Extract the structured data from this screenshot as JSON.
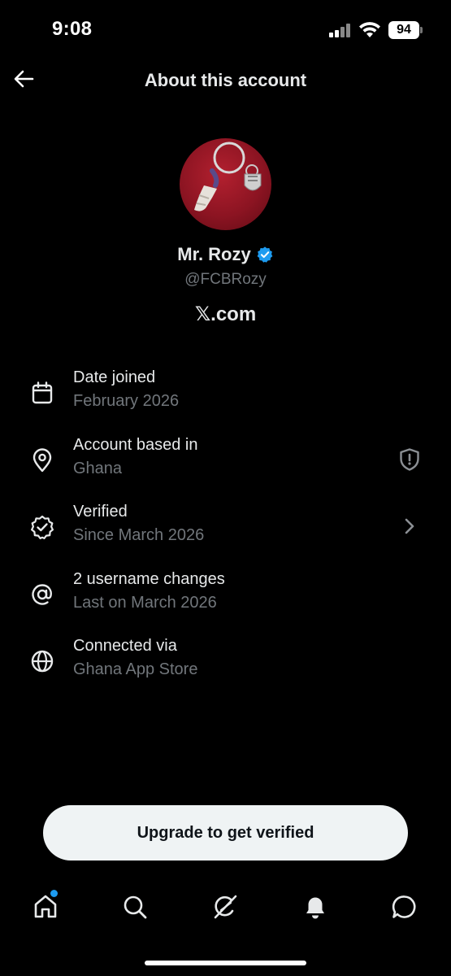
{
  "status_bar": {
    "time": "9:08",
    "battery": "94",
    "icons": [
      "signal-icon",
      "wifi-icon",
      "battery-icon"
    ]
  },
  "header": {
    "title": "About this account",
    "back_icon": "arrow-left-icon"
  },
  "profile": {
    "display_name": "Mr. Rozy",
    "handle": "@FCBRozy",
    "site": "𝕏.com",
    "verified_color": "#1d9bf0"
  },
  "info_items": [
    {
      "icon": "calendar-icon",
      "title": "Date joined",
      "subtitle": "February 2026"
    },
    {
      "icon": "location-pin-icon",
      "title": "Account based in",
      "subtitle": "Ghana",
      "trailing": "shield-alert-icon"
    },
    {
      "icon": "verified-check-icon",
      "title": "Verified",
      "subtitle": "Since March 2026",
      "trailing": "chevron-right-icon"
    },
    {
      "icon": "at-sign-icon",
      "title": "2 username changes",
      "subtitle": "Last on March 2026"
    },
    {
      "icon": "globe-icon",
      "title": "Connected via",
      "subtitle": "Ghana App Store"
    }
  ],
  "upgrade_button": {
    "label": "Upgrade to get verified"
  },
  "tab_bar": {
    "tabs": [
      "home-icon",
      "search-icon",
      "grok-icon",
      "notifications-icon",
      "messages-icon"
    ],
    "accent_color": "#1d9bf0"
  }
}
